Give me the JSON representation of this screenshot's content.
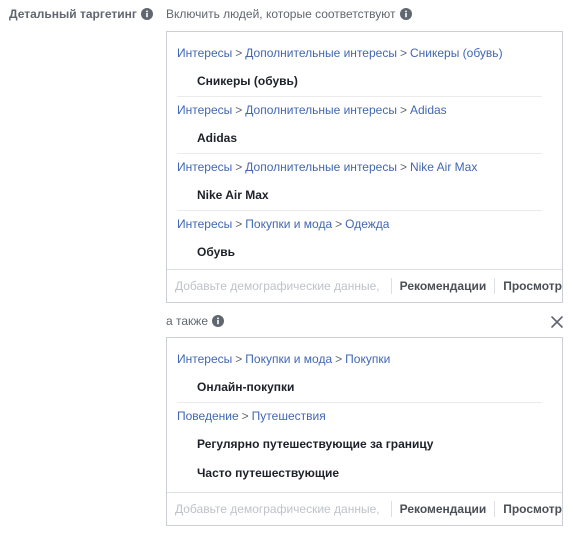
{
  "detailed_targeting": {
    "label": "Детальный таргетинг"
  },
  "include": {
    "label": "Включить людей, которые соответствуют",
    "groups": [
      {
        "path": [
          "Интересы",
          "Дополнительные интересы",
          "Сникеры (обувь)"
        ],
        "items": [
          "Сникеры (обувь)"
        ]
      },
      {
        "path": [
          "Интересы",
          "Дополнительные интересы",
          "Adidas"
        ],
        "items": [
          "Adidas"
        ]
      },
      {
        "path": [
          "Интересы",
          "Дополнительные интересы",
          "Nike Air Max"
        ],
        "items": [
          "Nike Air Max"
        ]
      },
      {
        "path": [
          "Интересы",
          "Покупки и мода",
          "Одежда"
        ],
        "items": [
          "Обувь"
        ]
      }
    ],
    "footer": {
      "placeholder": "Добавьте демографические данные, и",
      "recommendations": "Рекомендации",
      "browse": "Просмотр"
    }
  },
  "also": {
    "label": "а также",
    "groups": [
      {
        "path": [
          "Интересы",
          "Покупки и мода",
          "Покупки"
        ],
        "items": [
          "Онлайн-покупки"
        ]
      },
      {
        "path": [
          "Поведение",
          "Путешествия"
        ],
        "items": [
          "Регулярно путешествующие за границу",
          "Часто путешествующие"
        ]
      }
    ],
    "footer": {
      "placeholder": "Добавьте демографические данные, и",
      "recommendations": "Рекомендации",
      "browse": "Просмотр"
    }
  },
  "icons": {
    "info": "info-icon",
    "close": "close-icon"
  },
  "colors": {
    "link": "#4267b2",
    "label": "#606770",
    "text": "#1d2129",
    "border": "#ccd0d5"
  }
}
